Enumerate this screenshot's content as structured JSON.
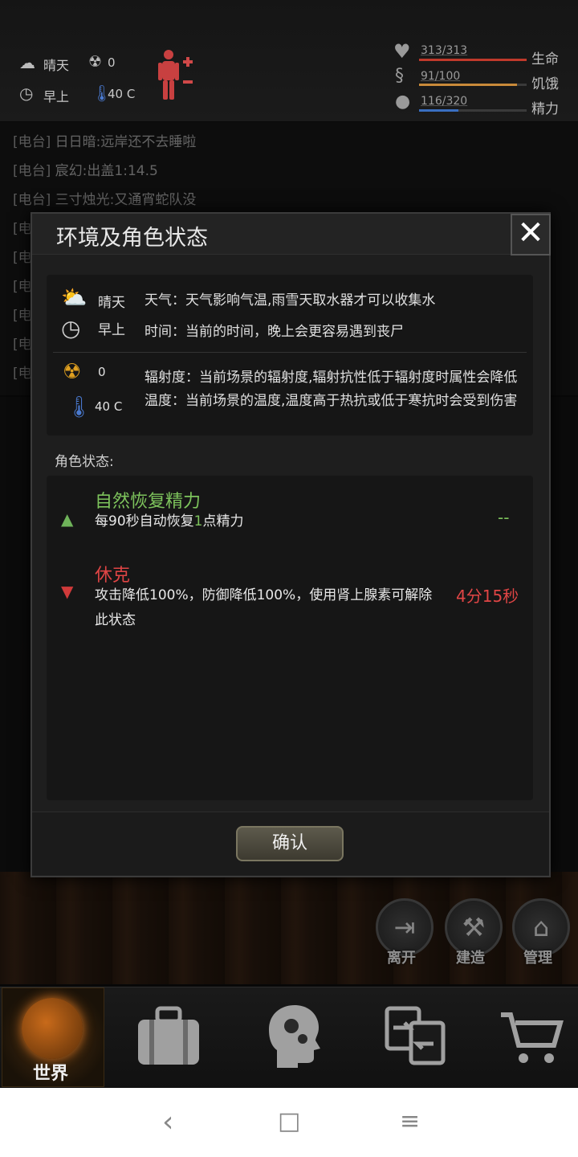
{
  "topbar": {
    "weather": "晴天",
    "radiation": "0",
    "time": "早上",
    "temperature": "40 C",
    "stats": [
      {
        "value": "313/313",
        "label": "生命",
        "fill": 1.0,
        "color": "#c0392b"
      },
      {
        "value": "91/100",
        "label": "饥饿",
        "fill": 0.91,
        "color": "#c98a3a"
      },
      {
        "value": "116/320",
        "label": "精力",
        "fill": 0.3625,
        "color": "#3a6fc0"
      }
    ]
  },
  "chat": [
    {
      "tag": "[电台]",
      "text": "日日暗:远岸还不去睡啦"
    },
    {
      "tag": "[电台]",
      "text": "宸幻:出盖1:14.5"
    },
    {
      "tag": "[电台]",
      "text": "三寸烛光:又通宵蛇队没"
    },
    {
      "tag": "[电",
      "text": ""
    },
    {
      "tag": "[电",
      "text": ""
    },
    {
      "tag": "[电",
      "text": ""
    },
    {
      "tag": "[电",
      "text": ""
    },
    {
      "tag": "[电",
      "text": ""
    },
    {
      "tag": "[电",
      "text": ""
    }
  ],
  "modal": {
    "title": "环境及角色状态",
    "weather_value": "晴天",
    "time_value": "早上",
    "weather_desc": "天气：天气影响气温,雨雪天取水器才可以收集水",
    "time_desc": "时间：当前的时间，晚上会更容易遇到丧尸",
    "radiation_value": "0",
    "temperature_value": "40 C",
    "radiation_desc": "辐射度：当前场景的辐射度,辐射抗性低于辐射度时属性会降低",
    "temperature_desc": "温度：当前场景的温度,温度高于热抗或低于寒抗时会受到伤害",
    "section_label": "角色状态:",
    "statuses": [
      {
        "name": "自然恢复精力",
        "desc_pre": "每90秒自动恢复",
        "desc_num": "1",
        "desc_post": "点精力",
        "time": "--"
      },
      {
        "name": "休克",
        "desc_line1": "攻击降低100%，防御降低100%，使用肾上腺素可解除",
        "desc_line2": "此状态",
        "time": "4分15秒"
      }
    ],
    "confirm_label": "确认"
  },
  "actions": [
    {
      "label": "离开",
      "icon": "person-exit-icon"
    },
    {
      "label": "建造",
      "icon": "hammer-icon"
    },
    {
      "label": "管理",
      "icon": "house-gear-icon"
    }
  ],
  "bottomnav": {
    "world_label": "世界"
  },
  "system_nav": {
    "back": "‹",
    "home": "□",
    "menu": "≡"
  }
}
